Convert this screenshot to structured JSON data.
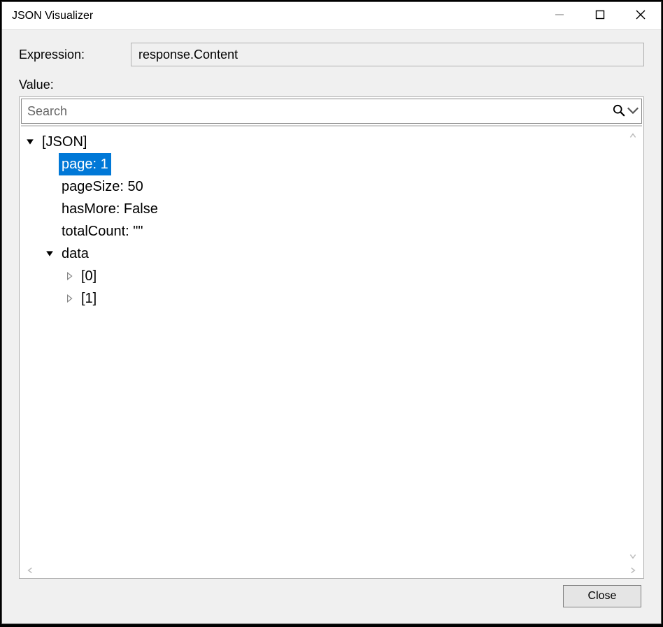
{
  "window": {
    "title": "JSON Visualizer"
  },
  "expression": {
    "label": "Expression:",
    "value": "response.Content"
  },
  "value_section": {
    "label": "Value:"
  },
  "search": {
    "placeholder": "Search"
  },
  "tree": {
    "root": "[JSON]",
    "nodes": {
      "page": "page: 1",
      "pageSize": "pageSize: 50",
      "hasMore": "hasMore: False",
      "totalCount": "totalCount: \"\"",
      "data": "data",
      "data_0": "[0]",
      "data_1": "[1]"
    }
  },
  "footer": {
    "close": "Close"
  }
}
